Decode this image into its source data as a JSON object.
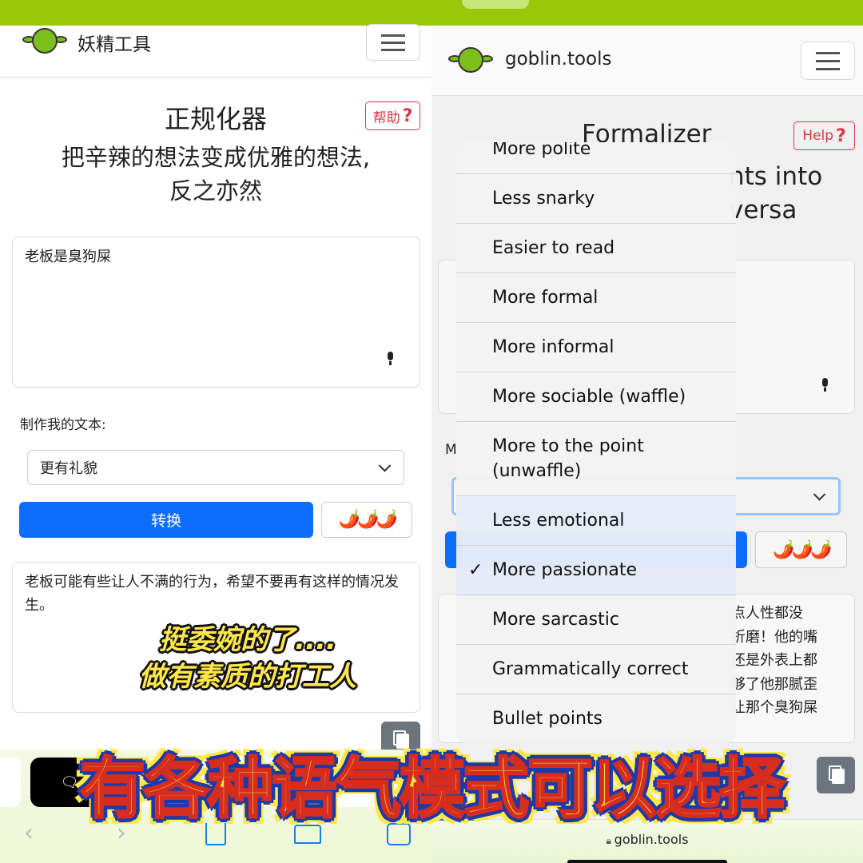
{
  "colors": {
    "brand_green": "#98c807",
    "primary": "#0d6efd",
    "help_red": "#dc3545",
    "caption_yellow": "#ffe94a"
  },
  "left": {
    "brand": "妖精工具",
    "title": "正规化器",
    "help": "帮助",
    "help_icon": "?",
    "subtitle_line1": "把辛辣的想法变成优雅的想法,",
    "subtitle_line2": "反之亦然",
    "input_value": "老板是臭狗屎",
    "label": "制作我的文本:",
    "select_value": "更有礼貌",
    "convert": "转换",
    "spiciness": "🌶️🌶️🌶️",
    "output": "老板可能有些让人不满的行为，希望不要再有这样的情况发生。",
    "caption_line1": "挺委婉的了....",
    "caption_line2": "做有素质的打工人"
  },
  "right": {
    "brand": "goblin.tools",
    "title": "Formalizer",
    "help": "Help",
    "help_icon": "?",
    "subtitle_line1_partial": "nts into",
    "subtitle_line2_partial": "versa",
    "label_partial": "M",
    "spiciness": "🌶️🌶️🌶️",
    "output_fragments": [
      "点人性都没",
      "折磨！他的嘴",
      "还是外表上都",
      "够了他那腻歪",
      "让那个臭狗屎"
    ],
    "url": "goblin.tools",
    "dropdown": {
      "options": [
        "More polite",
        "Less snarky",
        "Easier to read",
        "More formal",
        "More informal",
        "More sociable (waffle)",
        "More to the point (unwaffle)",
        "Less emotional",
        "More passionate",
        "More sarcastic",
        "Grammatically correct",
        "Bullet points"
      ],
      "selected": "More passionate"
    }
  },
  "banner_caption": "有各种语气模式可以选择"
}
